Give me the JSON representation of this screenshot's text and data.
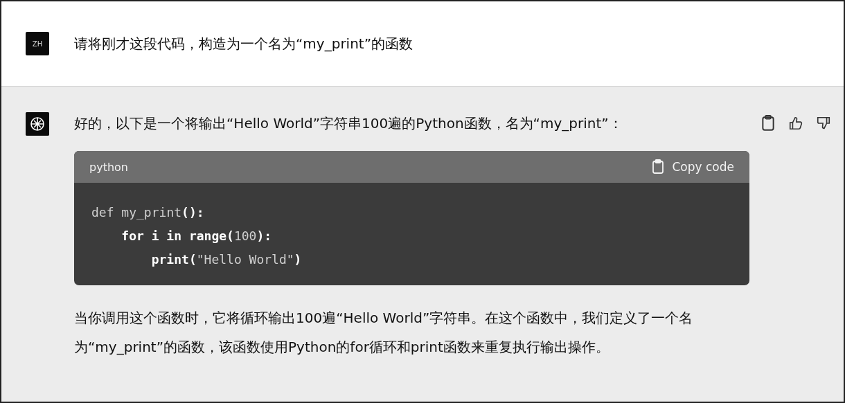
{
  "user_message": {
    "avatar": "ZH",
    "text": "请将刚才这段代码，构造为一个名为“my_print”的函数"
  },
  "assistant_message": {
    "intro": "好的，以下是一个将输出“Hello World”字符串100遍的Python函数，名为“my_print”：",
    "code_block": {
      "language": "python",
      "copy_label": "Copy code",
      "lines": [
        [
          {
            "text": "def ",
            "kind": "dim"
          },
          {
            "text": "my_print",
            "kind": "dim"
          },
          {
            "text": "():",
            "kind": "bold"
          }
        ],
        [
          {
            "text": "    for i in range(",
            "kind": "bold"
          },
          {
            "text": "100",
            "kind": "dim"
          },
          {
            "text": "):",
            "kind": "bold"
          }
        ],
        [
          {
            "text": "        print(",
            "kind": "bold"
          },
          {
            "text": "\"Hello World\"",
            "kind": "dim"
          },
          {
            "text": ")",
            "kind": "bold"
          }
        ]
      ]
    },
    "explanation": "当你调用这个函数时，它将循环输出100遍“Hello World”字符串。在这个函数中，我们定义了一个名为“my_print”的函数，该函数使用Python的for循环和print函数来重复执行输出操作。"
  }
}
